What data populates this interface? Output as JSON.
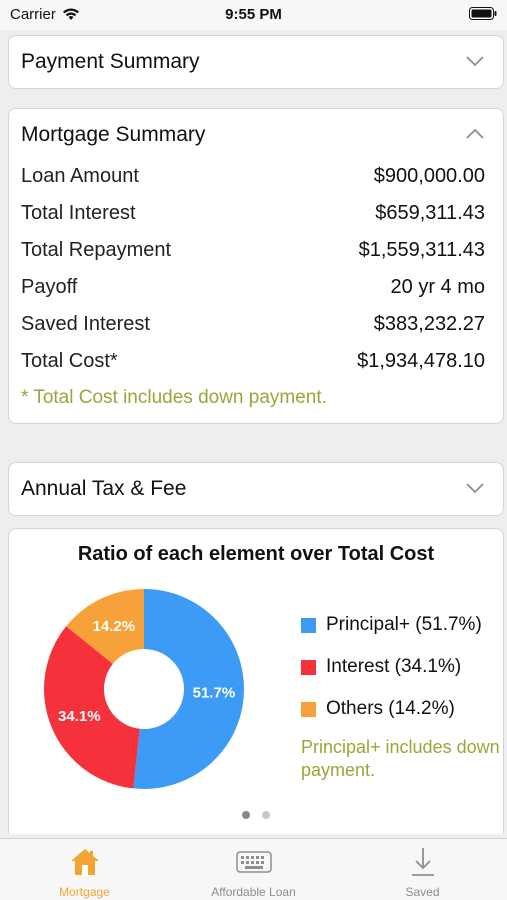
{
  "status": {
    "carrier": "Carrier",
    "time": "9:55 PM"
  },
  "payment_summary": {
    "title": "Payment Summary"
  },
  "mortgage_summary": {
    "title": "Mortgage Summary",
    "rows": [
      {
        "label": "Loan Amount",
        "value": "$900,000.00"
      },
      {
        "label": "Total Interest",
        "value": "$659,311.43"
      },
      {
        "label": "Total Repayment",
        "value": "$1,559,311.43"
      },
      {
        "label": "Payoff",
        "value": "20 yr 4 mo"
      },
      {
        "label": "Saved Interest",
        "value": "$383,232.27"
      },
      {
        "label": "Total Cost*",
        "value": "$1,934,478.10"
      }
    ],
    "note": "* Total Cost includes down payment."
  },
  "annual_tax": {
    "title": "Annual Tax & Fee"
  },
  "chart_data": {
    "type": "pie",
    "title": "Ratio of each element over Total Cost",
    "categories": [
      "Principal+",
      "Interest",
      "Others"
    ],
    "values": [
      51.7,
      34.1,
      14.2
    ],
    "labels": [
      "51.7%",
      "34.1%",
      "14.2%"
    ],
    "legend": [
      "Principal+ (51.7%)",
      "Interest (34.1%)",
      "Others (14.2%)"
    ],
    "colors": [
      "#3d9bf5",
      "#f5323c",
      "#f7a13a"
    ],
    "legend_placement": "right",
    "note": "Principal+ includes down payment."
  },
  "tabs": [
    {
      "label": "Mortgage",
      "icon": "house-icon",
      "active": true
    },
    {
      "label": "Affordable Loan",
      "icon": "keyboard-icon",
      "active": false
    },
    {
      "label": "Saved",
      "icon": "download-arrow-icon",
      "active": false
    }
  ]
}
